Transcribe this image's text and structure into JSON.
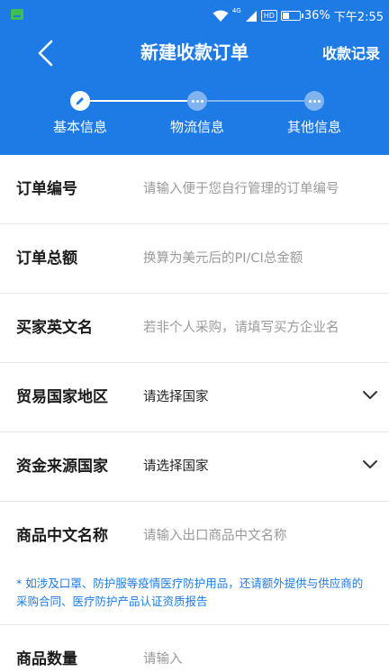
{
  "status_bar": {
    "network": "4G",
    "hd": "HD",
    "battery": "36%",
    "battery_level": 0.36,
    "time": "下午2:55"
  },
  "header": {
    "title": "新建收款订单",
    "records_label": "收款记录",
    "background": "#1e7be6"
  },
  "steps": [
    {
      "label": "基本信息",
      "state": "active",
      "icon": "pencil-icon"
    },
    {
      "label": "物流信息",
      "state": "pending",
      "icon": "dots-icon"
    },
    {
      "label": "其他信息",
      "state": "pending",
      "icon": "dots-icon"
    }
  ],
  "form": {
    "order_no": {
      "label": "订单编号",
      "placeholder": "请输入便于您自行管理的订单编号"
    },
    "order_total": {
      "label": "订单总额",
      "placeholder": "换算为美元后的PI/CI总金额"
    },
    "buyer_name": {
      "label": "买家英文名",
      "placeholder": "若非个人采购，请填写买方企业名"
    },
    "trade_country": {
      "label": "贸易国家地区",
      "value": "请选择国家"
    },
    "fund_country": {
      "label": "资金来源国家",
      "value": "请选择国家"
    },
    "product_cn": {
      "label": "商品中文名称",
      "placeholder": "请输入出口商品中文名称"
    },
    "notice": "* 如涉及口罩、防护服等疫情医疗防护用品，还请额外提供与供应商的采购合同、医疗防护产品认证资质报告",
    "quantity": {
      "label": "商品数量",
      "placeholder": "请输入"
    }
  }
}
